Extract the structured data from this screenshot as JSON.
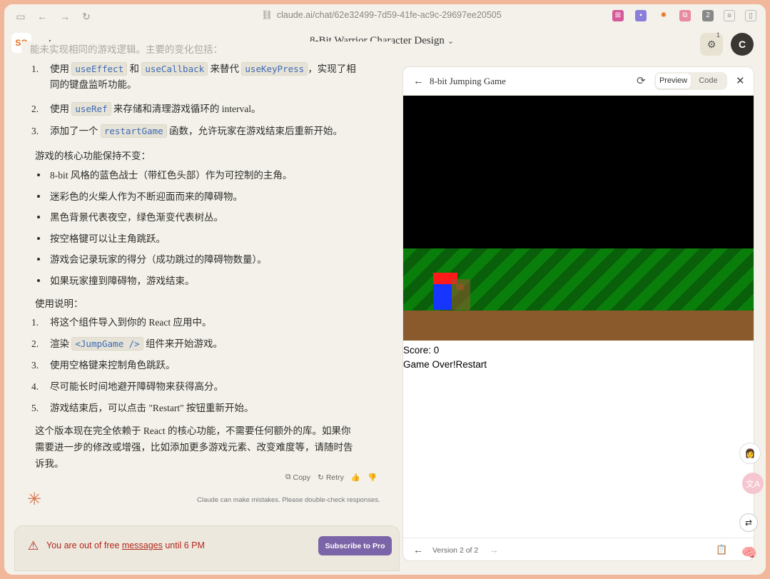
{
  "browser": {
    "url": "claude.ai/chat/62e32499-7d59-41fe-ac9c-29697ee20505"
  },
  "header": {
    "logo_text": "SO",
    "title": "8-Bit Warrior Character Design",
    "settings_badge": "1",
    "avatar_letter": "C"
  },
  "chat": {
    "cut_line": "能未实现相同的游戏逻辑。主要的变化包括：",
    "changes": [
      {
        "num": "1.",
        "pre": "使用 ",
        "code1": "useEffect",
        "mid": " 和 ",
        "code2": "useCallback",
        "mid2": " 来替代 ",
        "code3": "useKeyPress",
        "post": "，实现了相",
        "cont": "同的键盘监听功能。"
      },
      {
        "num": "2.",
        "pre": "使用 ",
        "code1": "useRef",
        "post": " 来存储和清理游戏循环的 interval。"
      },
      {
        "num": "3.",
        "pre": "添加了一个 ",
        "code1": "restartGame",
        "post": " 函数，允许玩家在游戏结束后重新开始。"
      }
    ],
    "core_heading": "游戏的核心功能保持不变：",
    "core_items": [
      "8-bit 风格的蓝色战士（带红色头部）作为可控制的主角。",
      "迷彩色的火柴人作为不断迎面而来的障碍物。",
      "黑色背景代表夜空，绿色渐变代表树丛。",
      "按空格键可以让主角跳跃。",
      "游戏会记录玩家的得分（成功跳过的障碍物数量）。",
      "如果玩家撞到障碍物，游戏结束。"
    ],
    "usage_heading": "使用说明：",
    "usage_items": [
      {
        "num": "1.",
        "text": "将这个组件导入到你的 React 应用中。"
      },
      {
        "num": "2.",
        "pre": "渲染 ",
        "code": "<JumpGame />",
        "post": " 组件来开始游戏。"
      },
      {
        "num": "3.",
        "text": "使用空格键来控制角色跳跃。"
      },
      {
        "num": "4.",
        "text": "尽可能长时间地避开障碍物来获得高分。"
      },
      {
        "num": "5.",
        "text": "游戏结束后，可以点击 \"Restart\" 按钮重新开始。"
      }
    ],
    "closing": [
      "这个版本现在完全依赖于 React 的核心功能，不需要任何额外的库。如果你",
      "需要进一步的修改或增强，比如添加更多游戏元素、改变难度等，请随时告",
      "诉我。"
    ],
    "actions": {
      "copy": "Copy",
      "retry": "Retry"
    },
    "disclaimer": "Claude can make mistakes. Please double-check responses."
  },
  "alert": {
    "pre": "You are out of free ",
    "link": "messages",
    "post": " until 6 PM",
    "button": "Subscribe to Pro"
  },
  "artifact": {
    "title": "8-bit Jumping Game",
    "tab_preview": "Preview",
    "tab_code": "Code",
    "score_label": "Score: 0",
    "game_over": "Game Over!",
    "restart": "Restart",
    "version": "Version 2 of 2"
  },
  "colors": {
    "sky": "#000000",
    "forest_light": "#0a7e0a",
    "forest_dark": "#0a5f0a",
    "ground": "#8a5a2c",
    "hero_head": "#ff1a1a",
    "hero_body": "#1636ff",
    "subscribe": "#7c64a8",
    "alert_text": "#b3261e"
  }
}
